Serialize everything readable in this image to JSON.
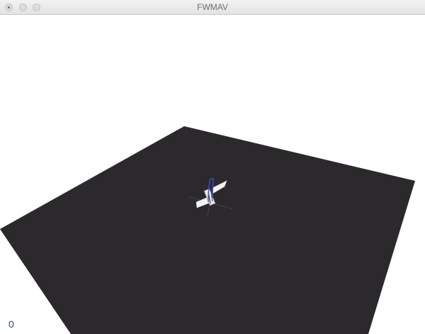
{
  "window": {
    "title": "FWMAV"
  },
  "viewport": {
    "frame_counter": "0",
    "floor_color": "#2b292c",
    "model_color": "#f4f4f4",
    "trail_color": "#3a4fd0"
  }
}
